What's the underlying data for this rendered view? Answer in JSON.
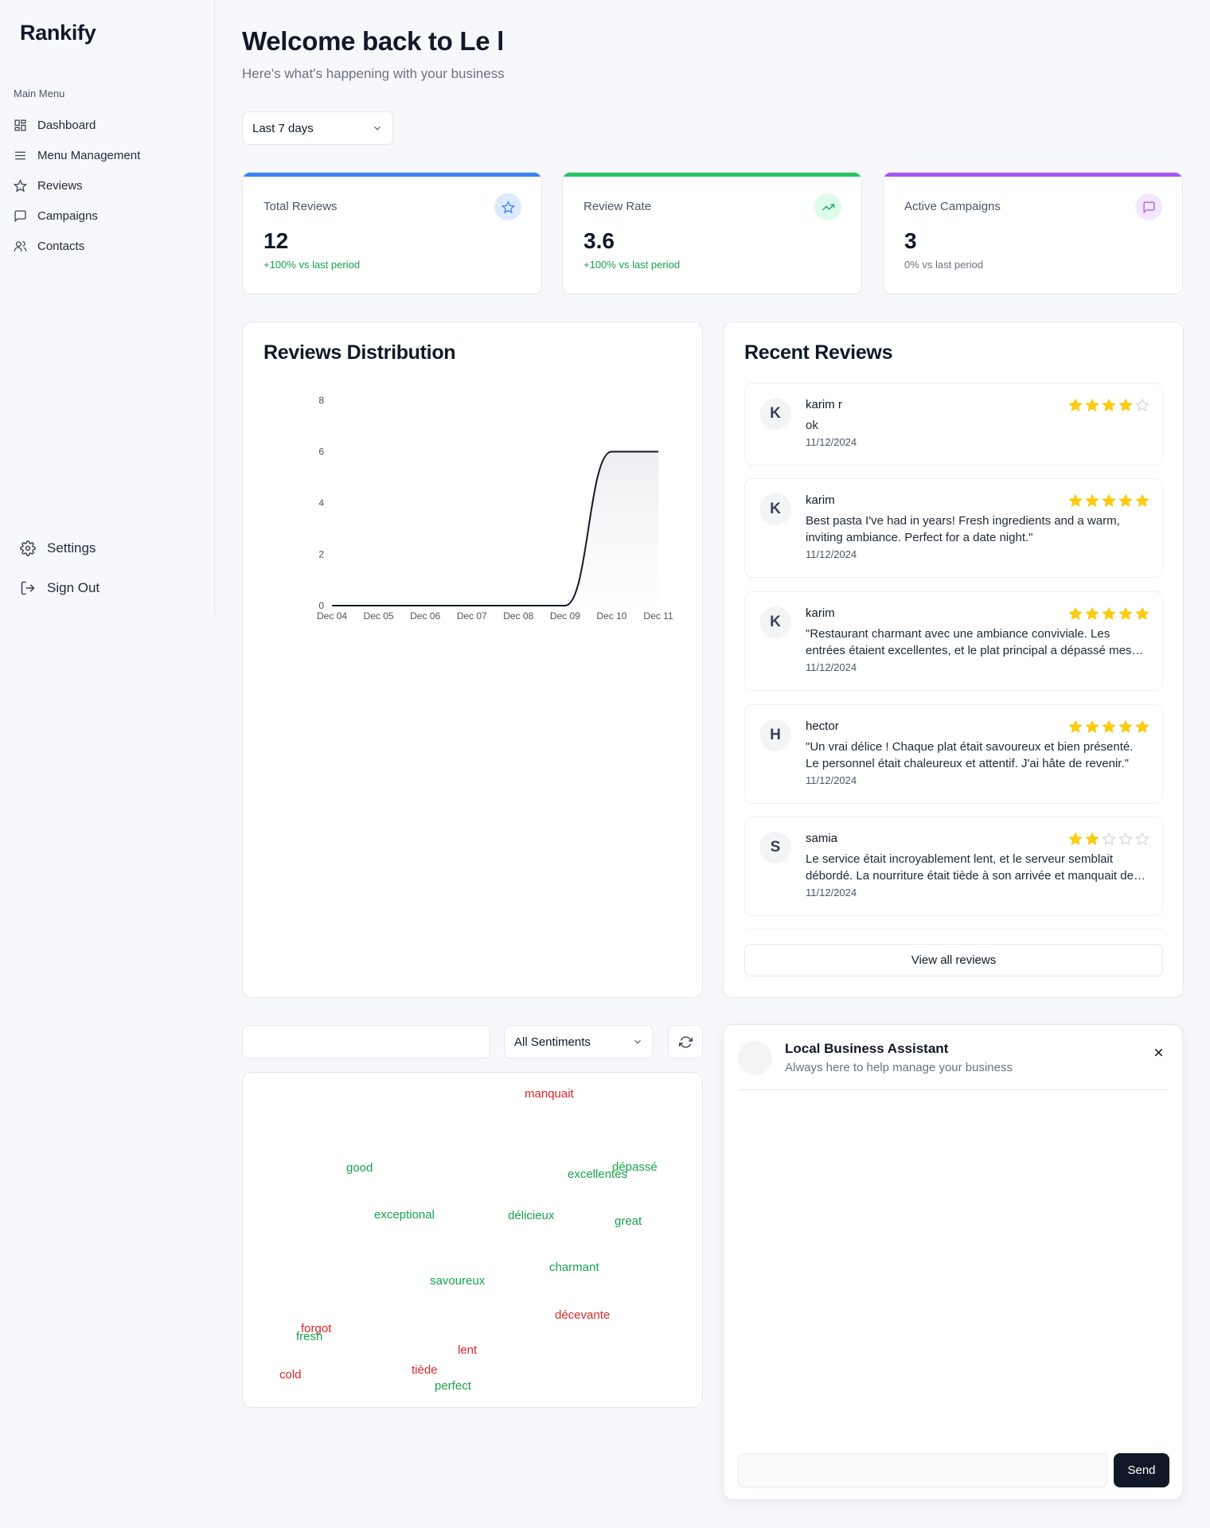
{
  "sidebar": {
    "brand": "Rankify",
    "menu_label": "Main Menu",
    "items": [
      {
        "label": "Dashboard"
      },
      {
        "label": "Menu Management"
      },
      {
        "label": "Reviews"
      },
      {
        "label": "Campaigns"
      },
      {
        "label": "Contacts"
      }
    ],
    "settings_label": "Settings",
    "signout_label": "Sign Out"
  },
  "header": {
    "title": "Welcome back to Le l",
    "subtitle": "Here's what's happening with your business"
  },
  "period_select": {
    "value": "Last 7 days"
  },
  "stats": [
    {
      "label": "Total Reviews",
      "value": "12",
      "change": "+100% vs last period",
      "accent": "#3b82f6",
      "icon": "star-icon"
    },
    {
      "label": "Review Rate",
      "value": "3.6",
      "change": "+100% vs last period",
      "accent": "#22c55e",
      "icon": "trending-up-icon"
    },
    {
      "label": "Active Campaigns",
      "value": "3",
      "change": "0% vs last period",
      "accent": "#a855f7",
      "icon": "message-square-icon"
    }
  ],
  "distribution": {
    "title": "Reviews Distribution"
  },
  "chart_data": {
    "type": "area",
    "title": "Reviews Distribution",
    "x": [
      "Dec 04",
      "Dec 05",
      "Dec 06",
      "Dec 07",
      "Dec 08",
      "Dec 09",
      "Dec 10",
      "Dec 11"
    ],
    "series": [
      {
        "values": [
          0,
          0,
          0,
          0,
          0,
          0,
          6,
          6
        ]
      }
    ],
    "yticks": [
      "0",
      "2",
      "4",
      "6",
      "8"
    ],
    "ylim": [
      0,
      8
    ],
    "grid": false
  },
  "recent": {
    "title": "Recent Reviews",
    "reviews": [
      {
        "initial": "K",
        "name": "karim r",
        "text": "ok",
        "date": "11/12/2024",
        "rating": 4
      },
      {
        "initial": "K",
        "name": "karim",
        "text": "Best pasta I've had in years! Fresh ingredients and a warm, inviting ambiance. Perfect for a date night.\"",
        "date": "11/12/2024",
        "rating": 5
      },
      {
        "initial": "K",
        "name": "karim",
        "text": "\"Restaurant charmant avec une ambiance conviviale. Les entrées étaient excellentes, et le plat principal a dépassé mes attentes.\"",
        "date": "11/12/2024",
        "rating": 5
      },
      {
        "initial": "H",
        "name": "hector",
        "text": "\"Un vrai délice ! Chaque plat était savoureux et bien présenté. Le personnel était chaleureux et attentif. J'ai hâte de revenir.\"",
        "date": "11/12/2024",
        "rating": 5
      },
      {
        "initial": "S",
        "name": "samia",
        "text": "Le service était incroyablement lent, et le serveur semblait débordé. La nourriture était tiède à son arrivée et manquait de saveur.",
        "date": "11/12/2024",
        "rating": 2
      }
    ],
    "view_all_label": "View all reviews"
  },
  "filters": {
    "search_value": "",
    "sentiment_select": "All Sentiments"
  },
  "word_cloud": [
    {
      "word": "manquait",
      "sentiment": "negative"
    },
    {
      "word": "good",
      "sentiment": "positive"
    },
    {
      "word": "excellentes",
      "sentiment": "positive"
    },
    {
      "word": "dépassé",
      "sentiment": "positive"
    },
    {
      "word": "exceptional",
      "sentiment": "positive"
    },
    {
      "word": "délicieux",
      "sentiment": "positive"
    },
    {
      "word": "great",
      "sentiment": "positive"
    },
    {
      "word": "charmant",
      "sentiment": "positive"
    },
    {
      "word": "savoureux",
      "sentiment": "positive"
    },
    {
      "word": "décevante",
      "sentiment": "negative"
    },
    {
      "word": "forgot",
      "sentiment": "negative"
    },
    {
      "word": "fresh",
      "sentiment": "positive"
    },
    {
      "word": "lent",
      "sentiment": "negative"
    },
    {
      "word": "cold",
      "sentiment": "negative"
    },
    {
      "word": "tiède",
      "sentiment": "negative"
    },
    {
      "word": "perfect",
      "sentiment": "positive"
    }
  ],
  "assistant": {
    "title": "Local Business Assistant",
    "subtitle": "Always here to help manage your business",
    "input_value": "",
    "send_label": "Send"
  },
  "colors": {
    "positive": "#16a34a",
    "negative": "#dc2626",
    "star": "#facc15",
    "dark_button": "#111827"
  }
}
